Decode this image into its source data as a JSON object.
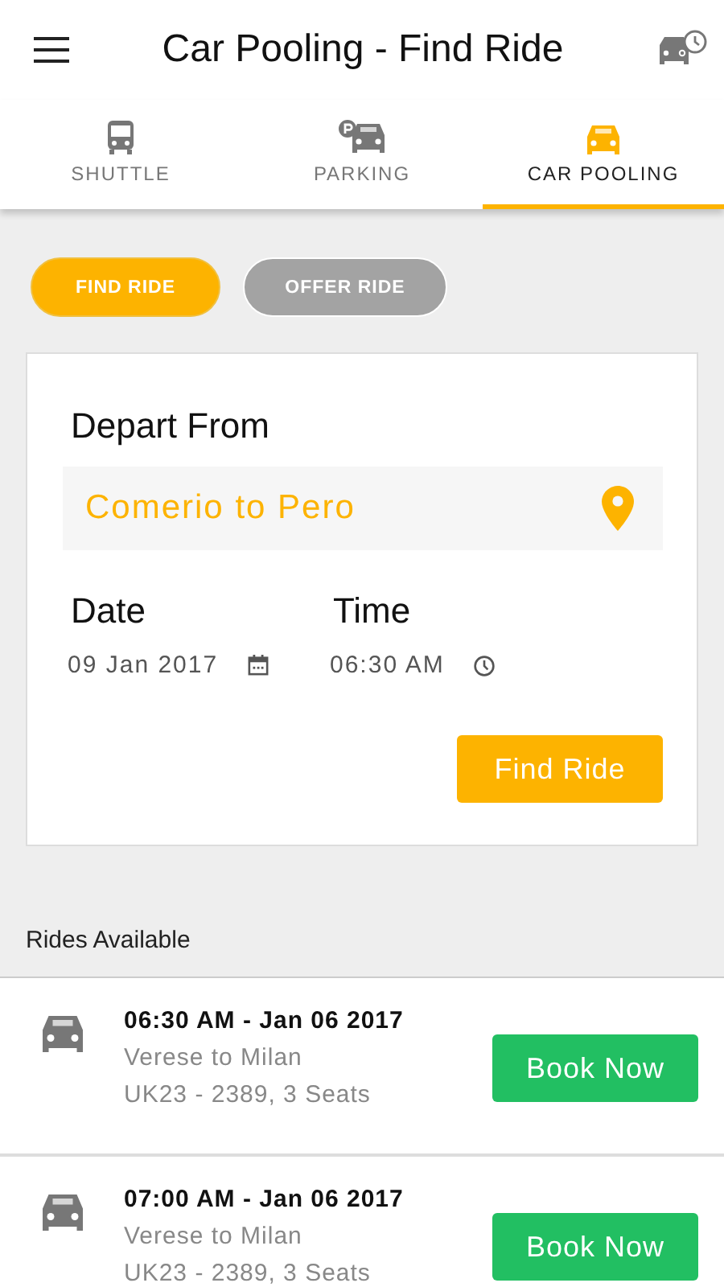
{
  "app_bar": {
    "title": "Car Pooling - Find Ride"
  },
  "tabs": [
    {
      "label": "SHUTTLE",
      "kind": "shuttle",
      "selected": false
    },
    {
      "label": "PARKING",
      "kind": "parking",
      "selected": false
    },
    {
      "label": "CAR POOLING",
      "kind": "carpool",
      "selected": true
    }
  ],
  "mode_toggle": [
    {
      "label": "FIND RIDE",
      "selected": true
    },
    {
      "label": "OFFER RIDE",
      "selected": false
    }
  ],
  "search_card": {
    "depart_label": "Depart From",
    "depart_value": "Comerio to Pero",
    "date_label": "Date",
    "date_value": "09 Jan 2017",
    "time_label": "Time",
    "time_value": "06:30 AM",
    "button": "Find Ride"
  },
  "rides_heading": "Rides Available",
  "rides": [
    {
      "when": "06:30 AM - Jan 06 2017",
      "route": "Verese to Milan",
      "vehicle": "UK23 - 2389, 3 Seats",
      "button": "Book Now"
    },
    {
      "when": "07:00 AM - Jan 06 2017",
      "route": "Verese to Milan",
      "vehicle": "UK23 - 2389, 3 Seats",
      "button": "Book Now"
    }
  ]
}
